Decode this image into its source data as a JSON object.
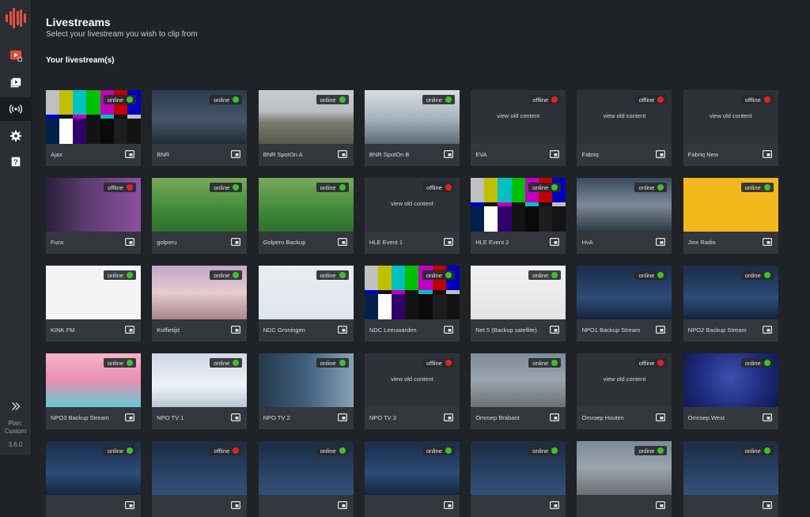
{
  "sidebar": {
    "logo_icon": "waveform-logo-icon",
    "nav": [
      {
        "icon": "clip-play-icon",
        "label": ""
      },
      {
        "icon": "video-library-icon",
        "label": ""
      },
      {
        "icon": "broadcast-icon",
        "label": ""
      },
      {
        "icon": "gear-icon",
        "label": ""
      },
      {
        "icon": "help-icon",
        "label": ""
      }
    ],
    "expand_icon": "double-chevron-right-icon",
    "plan_label": "Plan:",
    "plan_value": "Custom",
    "version": "3.6.0"
  },
  "page": {
    "title": "Livestreams",
    "subtitle": "Select your livestream you wish to clip from",
    "section_title": "Your livestream(s)"
  },
  "colors": {
    "online": "#3cc02f",
    "offline": "#e02424",
    "accent": "#e2513f"
  },
  "streams": [
    {
      "name": "Ajax",
      "status": "online"
    },
    {
      "name": "BNR",
      "status": "online"
    },
    {
      "name": "BNR SpotOn A",
      "status": "online"
    },
    {
      "name": "BNR SpotOn B",
      "status": "online"
    },
    {
      "name": "EVA",
      "status": "offline",
      "placeholder": "view old content"
    },
    {
      "name": "Fabriq",
      "status": "offline",
      "placeholder": "view old content"
    },
    {
      "name": "Fabriq New",
      "status": "offline",
      "placeholder": "view old content"
    },
    {
      "name": "Funx",
      "status": "offline"
    },
    {
      "name": "golperu",
      "status": "online"
    },
    {
      "name": "Golperu Backup",
      "status": "online"
    },
    {
      "name": "HLE Event 1",
      "status": "offline",
      "placeholder": "view old content"
    },
    {
      "name": "HLE Event 2",
      "status": "online"
    },
    {
      "name": "HvA",
      "status": "online"
    },
    {
      "name": "Jinx Radio",
      "status": "online"
    },
    {
      "name": "KINK FM",
      "status": "online"
    },
    {
      "name": "Koffietijd",
      "status": "online"
    },
    {
      "name": "NDC Groningen",
      "status": "online"
    },
    {
      "name": "NDC Leeuwarden",
      "status": "online"
    },
    {
      "name": "Net 5 (Backup satellite)",
      "status": "online"
    },
    {
      "name": "NPO1 Backup Stream",
      "status": "online"
    },
    {
      "name": "NPO2 Backup Stream",
      "status": "online"
    },
    {
      "name": "NPO3 Backup Stream",
      "status": "online"
    },
    {
      "name": "NPO TV 1",
      "status": "online"
    },
    {
      "name": "NPO TV 2",
      "status": "online"
    },
    {
      "name": "NPO TV 3",
      "status": "offline",
      "placeholder": "view old content"
    },
    {
      "name": "Omroep Brabant",
      "status": "online"
    },
    {
      "name": "Omroep Houten",
      "status": "offline",
      "placeholder": "view old content"
    },
    {
      "name": "Omroep West",
      "status": "online"
    },
    {
      "name": "",
      "status": "online"
    },
    {
      "name": "",
      "status": "offline"
    },
    {
      "name": "",
      "status": "online"
    },
    {
      "name": "",
      "status": "online"
    },
    {
      "name": "",
      "status": "online"
    },
    {
      "name": "",
      "status": "online"
    },
    {
      "name": "",
      "status": "online"
    }
  ],
  "status_labels": {
    "online": "online",
    "offline": "offline"
  }
}
